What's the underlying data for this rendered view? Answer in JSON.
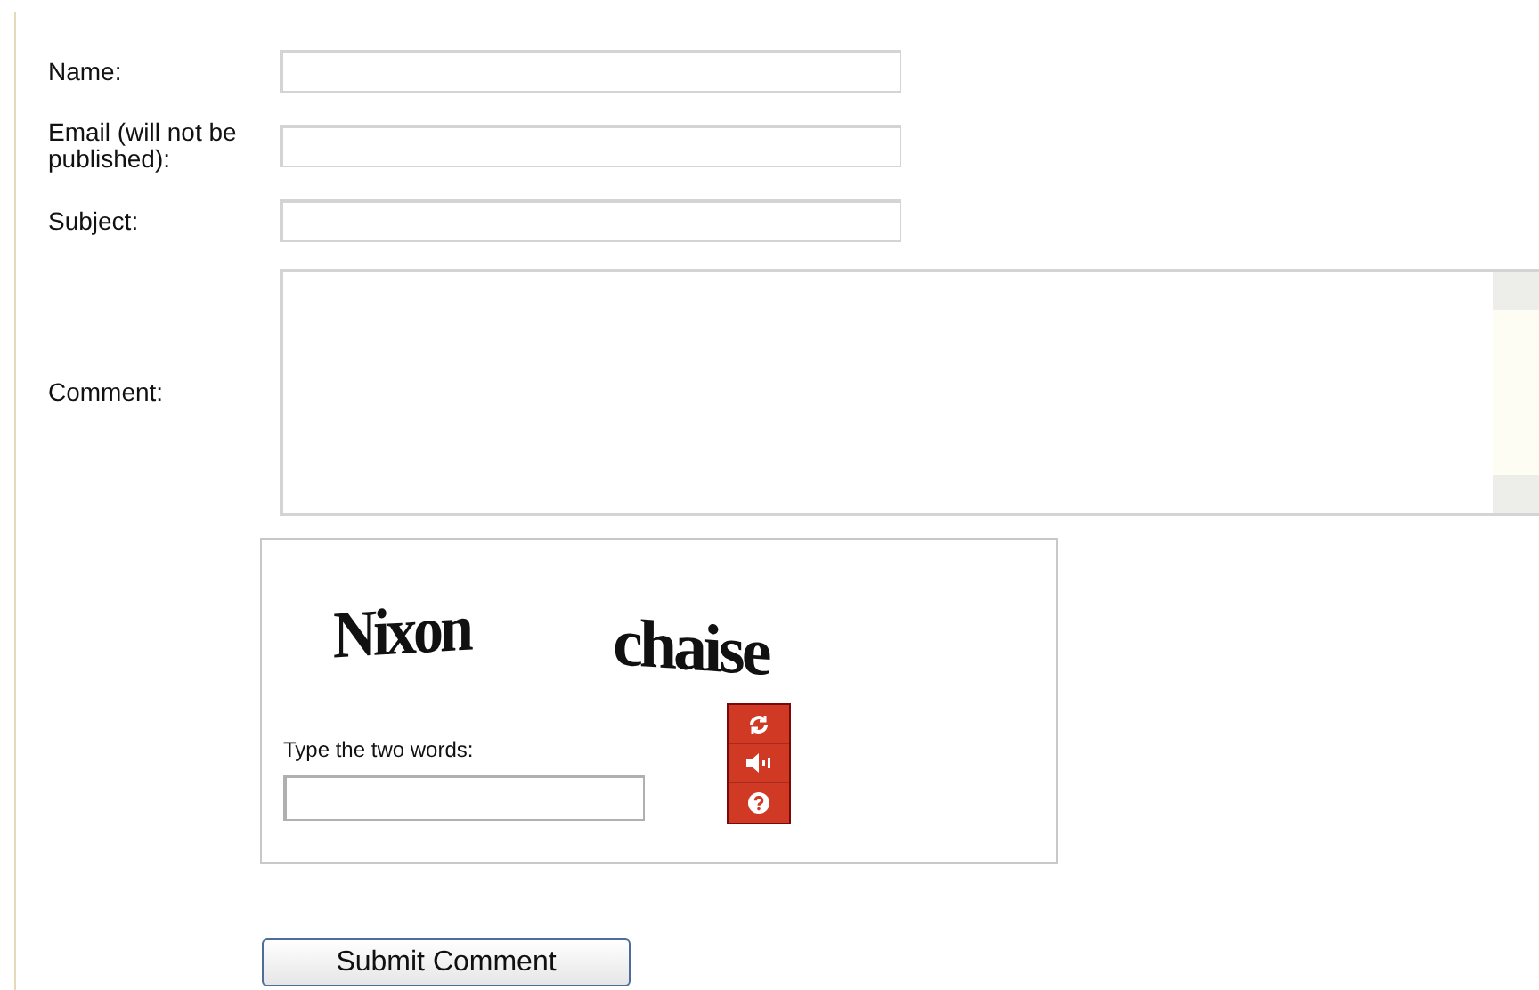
{
  "fields": [
    {
      "label": "Name:",
      "kind": "input"
    },
    {
      "label": "Email (will not be published):",
      "kind": "input"
    },
    {
      "label": "Subject:",
      "kind": "input"
    },
    {
      "label": "Comment:",
      "kind": "textarea"
    }
  ],
  "captcha": {
    "words": [
      "Nixon",
      "chaise"
    ],
    "prompt": "Type the two words:"
  },
  "submit": "Submit Comment"
}
